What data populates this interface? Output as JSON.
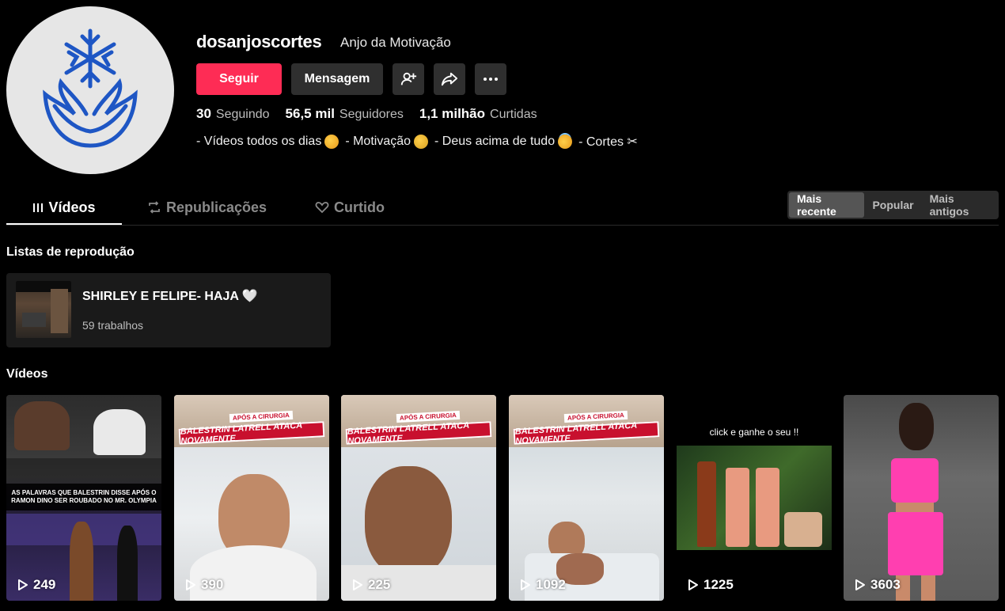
{
  "profile": {
    "username": "dosanjoscortes",
    "nickname": "Anjo da Motivação",
    "follow_label": "Seguir",
    "message_label": "Mensagem",
    "stats": [
      {
        "value": "30",
        "label": "Seguindo"
      },
      {
        "value": "56,5 mil",
        "label": "Seguidores"
      },
      {
        "value": "1,1 milhão",
        "label": "Curtidas"
      }
    ],
    "bio": {
      "part1": "- Vídeos todos os dias",
      "part2": "- Motivação",
      "part3": "- Deus acima de tudo",
      "part4": "- Cortes ✂"
    }
  },
  "tabs": [
    {
      "label": "Vídeos",
      "active": true
    },
    {
      "label": "Republicações",
      "active": false
    },
    {
      "label": "Curtido",
      "active": false
    }
  ],
  "sort": [
    "Mais recente",
    "Popular",
    "Mais antigos"
  ],
  "playlists": {
    "title": "Listas de reprodução",
    "items": [
      {
        "name": "SHIRLEY E FELIPE- HAJA 🤍",
        "count": "59 trabalhos"
      }
    ]
  },
  "videos": {
    "title": "Vídeos",
    "items": [
      {
        "views": "249",
        "caption": "AS PALAVRAS QUE BALESTRIN DISSE APÓS O RAMON DINO SER ROUBADO NO MR. OLYMPIA"
      },
      {
        "views": "390",
        "caption": "BALESTRIN LATRELL ATACA NOVAMENTE",
        "subcaption": "APÓS A CIRURGIA"
      },
      {
        "views": "225",
        "caption": "BALESTRIN LATRELL ATACA NOVAMENTE",
        "subcaption": "APÓS A CIRURGIA"
      },
      {
        "views": "1092",
        "caption": "BALESTRIN LATRELL ATACA NOVAMENTE",
        "subcaption": "APÓS A CIRURGIA"
      },
      {
        "views": "1225",
        "caption": "click e ganhe o seu !!"
      },
      {
        "views": "3603"
      }
    ]
  },
  "colors": {
    "accent": "#fe2c55",
    "background": "#000000",
    "button_dark": "#2f2f2f"
  }
}
